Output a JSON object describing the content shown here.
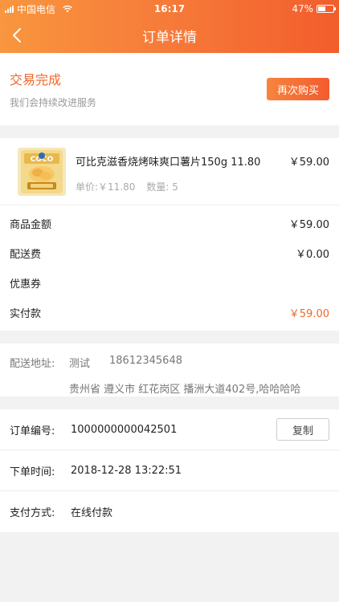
{
  "status_bar": {
    "carrier": "中国电信",
    "time": "16:17",
    "battery": "47%"
  },
  "nav": {
    "title": "订单详情"
  },
  "order_status": {
    "title": "交易完成",
    "subtitle": "我们会持续改进服务",
    "rebuy_label": "再次购买"
  },
  "product": {
    "image_name": "chips-product-image",
    "name": "可比克滋香烧烤味爽口薯片150g 11.80",
    "price": "￥59.00",
    "unit_price": "单价:￥11.80",
    "quantity": "数量: 5"
  },
  "amounts": [
    {
      "label": "商品金额",
      "value": "￥59.00"
    },
    {
      "label": "配送费",
      "value": "￥0.00"
    },
    {
      "label": "优惠券",
      "value": ""
    },
    {
      "label": "实付款",
      "value": "￥59.00"
    }
  ],
  "address": {
    "label": "配送地址:",
    "name": "测试",
    "phone": "18612345648",
    "detail": "贵州省 遵义市 红花岗区 播洲大道402号,哈哈哈哈"
  },
  "order_info": {
    "number_label": "订单编号:",
    "number": "1000000000042501",
    "copy_label": "复制",
    "time_label": "下单时间:",
    "time": "2018-12-28 13:22:51",
    "pay_label": "支付方式:",
    "pay": "在线付款"
  },
  "colors": {
    "accent": "#f0672b",
    "header_start": "#f9963f",
    "header_end": "#f25d2c"
  }
}
